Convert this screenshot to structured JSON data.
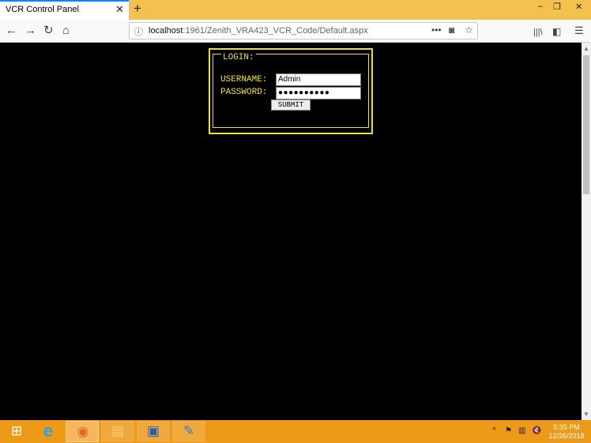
{
  "browser": {
    "tab_title": "VCR Control Panel",
    "tab_close": "✕",
    "new_tab": "+",
    "window_buttons": {
      "minimize": "–",
      "restore": "❐",
      "close": "✕"
    }
  },
  "navbar": {
    "back": "←",
    "forward": "→",
    "reload": "↻",
    "home": "⌂",
    "url_host": "localhost",
    "url_rest": ":1961/Zenith_VRA423_VCR_Code/Default.aspx",
    "page_actions": "•••",
    "pocket": "◙",
    "bookmark": "☆",
    "library": "|||\\",
    "sidebar": "◧",
    "menu": "☰"
  },
  "login": {
    "legend": "LOGIN:",
    "username_label": "USERNAME:",
    "username_value": "Admin",
    "password_label": "PASSWORD:",
    "password_value": "●●●●●●●●●●",
    "submit_label": "SUBMIT"
  },
  "taskbar": {
    "apps": [
      {
        "name": "windows-start",
        "glyph": "⊞",
        "color": "#ffffff"
      },
      {
        "name": "internet-explorer",
        "glyph": "e",
        "color": "#2aa0e6"
      },
      {
        "name": "firefox",
        "glyph": "◉",
        "color": "#e8641b"
      },
      {
        "name": "file-explorer",
        "glyph": "▤",
        "color": "#f5d272"
      },
      {
        "name": "remote-desktop",
        "glyph": "▣",
        "color": "#2a5db0"
      },
      {
        "name": "paint",
        "glyph": "✎",
        "color": "#3a7fd1"
      }
    ],
    "tray": {
      "chevron": "^",
      "flag": "⚑",
      "network": "▥",
      "volume": "🔇"
    },
    "time": "5:35 PM",
    "date": "12/26/2018"
  }
}
